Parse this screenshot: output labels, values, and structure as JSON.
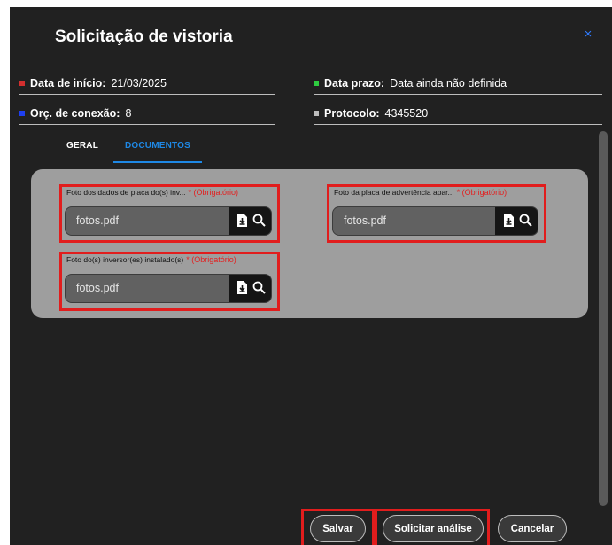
{
  "dialog": {
    "title": "Solicitação de vistoria",
    "close_symbol": "×"
  },
  "info": {
    "start": {
      "label": "Data de início:",
      "value": "21/03/2025",
      "color": "#d32f2f"
    },
    "deadline": {
      "label": "Data prazo:",
      "value": "Data ainda não definida",
      "color": "#2ecc40"
    },
    "connection": {
      "label": "Orç. de conexão:",
      "value": "8",
      "color": "#1e3ff0"
    },
    "protocol": {
      "label": "Protocolo:",
      "value": "4345520",
      "color": "#bdbdbd"
    }
  },
  "tabs": [
    {
      "label": "GERAL",
      "active": false
    },
    {
      "label": "DOCUMENTOS",
      "active": true
    }
  ],
  "documents": [
    {
      "label": "Foto dos dados de placa do(s) inv...",
      "required": "* (Obrigatório)",
      "value": "fotos.pdf"
    },
    {
      "label": "Foto da placa de advertência apar...",
      "required": "* (Obrigatório)",
      "value": "fotos.pdf"
    },
    {
      "label": "Foto do(s) inversor(es) instalado(s)",
      "required": "* (Obrigatório)",
      "value": "fotos.pdf"
    }
  ],
  "icons": {
    "download": "file-download-icon",
    "search": "search-icon"
  },
  "buttons": {
    "save": "Salvar",
    "request_analysis": "Solicitar análise",
    "cancel": "Cancelar"
  },
  "colors": {
    "tab_active": "#1e88e5",
    "highlight": "#e11d1d",
    "required": "#e32020"
  }
}
